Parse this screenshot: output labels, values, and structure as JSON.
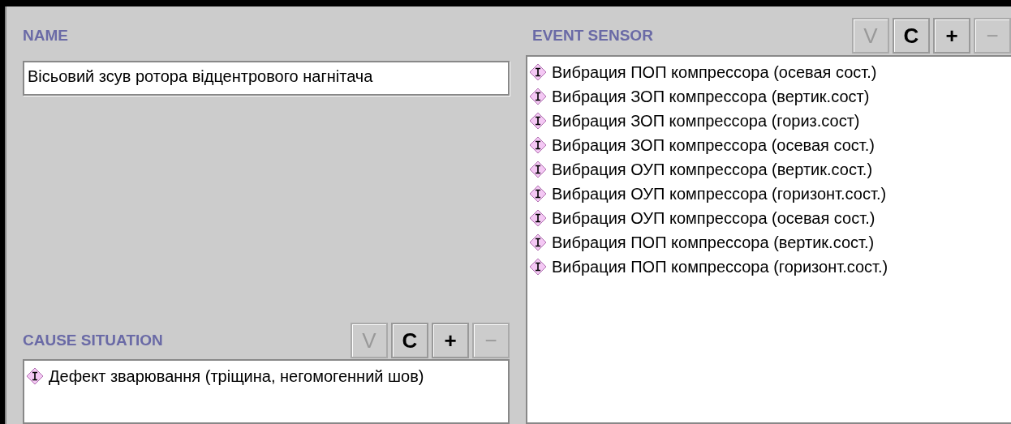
{
  "name_panel": {
    "label": "NAME",
    "value": "Вісьовий зсув ротора відцентрового нагнітача"
  },
  "cause_situation": {
    "label": "CAUSE SITUATION",
    "buttons": [
      {
        "label": "V",
        "disabled": true
      },
      {
        "label": "C",
        "disabled": false
      },
      {
        "label": "+",
        "disabled": false
      },
      {
        "label": "−",
        "disabled": true
      }
    ],
    "items": [
      "Дефект зварювання (тріщина, негомогенний шов)"
    ]
  },
  "event_sensor": {
    "label": "EVENT SENSOR",
    "buttons": [
      {
        "label": "V",
        "disabled": true
      },
      {
        "label": "C",
        "disabled": false
      },
      {
        "label": "+",
        "disabled": false
      },
      {
        "label": "−",
        "disabled": true
      }
    ],
    "items": [
      "Вибрация ПОП компрессора (осевая сост.)",
      "Вибрация ЗОП компрессора (вертик.сост)",
      "Вибрация ЗОП компрессора (гориз.сост)",
      "Вибрация ЗОП компрессора (осевая сост.)",
      "Вибрация ОУП компрессора (вертик.сост.)",
      "Вибрация ОУП компрессора (горизонт.сост.)",
      "Вибрация ОУП компрессора (осевая сост.)",
      "Вибрация ПОП компрессора (вертик.сост.)",
      "Вибрация ПОП компрессора (горизонт.сост.)"
    ]
  }
}
